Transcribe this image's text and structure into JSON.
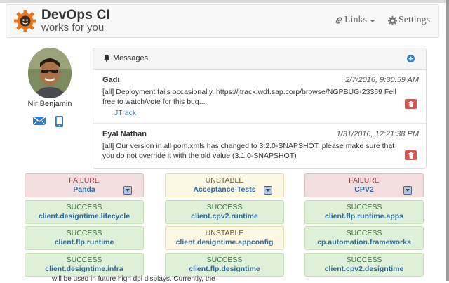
{
  "header": {
    "brand_title": "DevOps CI",
    "brand_subtitle": "works for you",
    "links_label": "Links",
    "settings_label": "Settings"
  },
  "profile": {
    "name": "Nir Benjamin"
  },
  "messages": {
    "title": "Messages",
    "items": [
      {
        "author": "Gadi",
        "date": "2/7/2016, 9:30:59 AM",
        "text": "[all] Deployment fails occasionally. https://jtrack.wdf.sap.corp/browse/NGPBUG-23369 Fell free to watch/vote for this bug...",
        "link": "JTrack"
      },
      {
        "author": "Eyal Nathan",
        "date": "1/31/2016, 12:21:38 PM",
        "text": "[all] Our version in all pom.xmls has changed to 3.2.0-SNAPSHOT, please make sure that you do not override it with the old value (3.1.0-SNAPSHOT)"
      }
    ]
  },
  "jobs": [
    {
      "status": "FAILURE",
      "name": "Panda",
      "expandable": true
    },
    {
      "status": "UNSTABLE",
      "name": "Acceptance-Tests",
      "expandable": true
    },
    {
      "status": "FAILURE",
      "name": "CPV2",
      "expandable": true
    },
    {
      "status": "SUCCESS",
      "name": "client.designtime.lifecycle"
    },
    {
      "status": "SUCCESS",
      "name": "client.cpv2.runtime"
    },
    {
      "status": "SUCCESS",
      "name": "client.flp.runtime.apps"
    },
    {
      "status": "SUCCESS",
      "name": "client.flp.runtime"
    },
    {
      "status": "UNSTABLE",
      "name": "client.designtime.appconfig"
    },
    {
      "status": "SUCCESS",
      "name": "cp.automation.frameworks"
    },
    {
      "status": "SUCCESS",
      "name": "client.designtime.infra"
    },
    {
      "status": "SUCCESS",
      "name": "client.flp.designtime"
    },
    {
      "status": "SUCCESS",
      "name": "client.cpv2.designtime"
    }
  ],
  "footer_text": "will be used in future high dpi displays. Currently, the",
  "colors": {
    "failure_bg": "#f2dede",
    "success_bg": "#dff0d8",
    "unstable_bg": "#fcf8e3",
    "danger": "#d9534f",
    "link": "#337ab7"
  }
}
